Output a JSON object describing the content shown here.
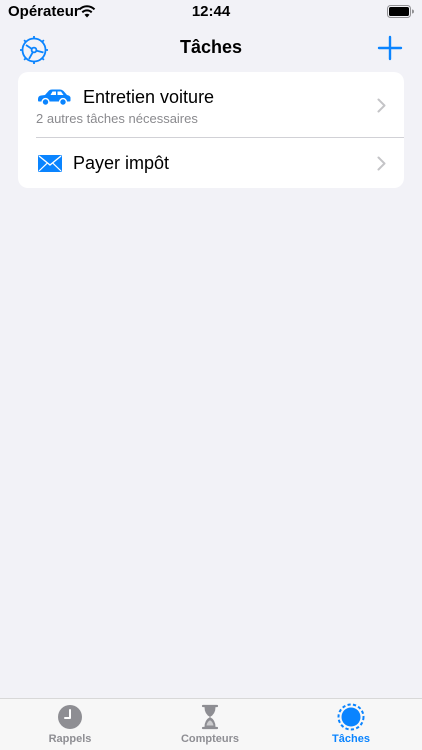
{
  "status_bar": {
    "carrier": "Opérateur",
    "time": "12:44"
  },
  "nav": {
    "title": "Tâches",
    "left_icon": "settings-gear-icon",
    "right_icon": "plus-icon"
  },
  "tasks": [
    {
      "icon": "car-icon",
      "title": "Entretien voiture",
      "subtitle": "2 autres tâches nécessaires"
    },
    {
      "icon": "envelope-icon",
      "title": "Payer impôt",
      "subtitle": ""
    }
  ],
  "tab_bar": {
    "tabs": [
      {
        "label": "Rappels",
        "icon": "clock-icon",
        "active": false
      },
      {
        "label": "Compteurs",
        "icon": "hourglass-icon",
        "active": false
      },
      {
        "label": "Tâches",
        "icon": "task-circle-icon",
        "active": true
      }
    ]
  },
  "colors": {
    "accent": "#0a84ff",
    "background": "#f2f2f7",
    "card": "#ffffff",
    "secondary_text": "#8a8a8e",
    "inactive_tab": "#8e8e93"
  }
}
